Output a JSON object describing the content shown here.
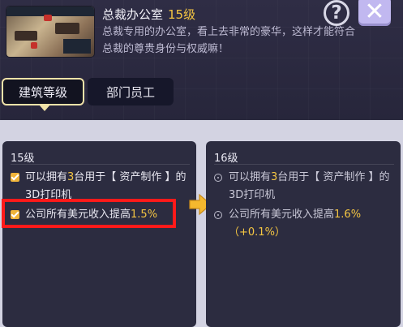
{
  "header": {
    "title": "总裁办公室",
    "level": "15级",
    "description": "总裁专用的办公室，看上去非常的豪华，这样才能符合总裁的尊贵身份与权威嘛！"
  },
  "buttons": {
    "help": "?",
    "close": "✕"
  },
  "tabs": [
    {
      "label": "建筑等级",
      "active": true
    },
    {
      "label": "部门员工",
      "active": false
    }
  ],
  "current": {
    "level": "15级",
    "items": [
      {
        "pre": "可以拥有",
        "num": "3",
        "post": "台用于【 资产制作 】的3D打印机"
      },
      {
        "pre": "公司所有美元收入提高",
        "num": "1.5%",
        "post": ""
      }
    ]
  },
  "next": {
    "level": "16级",
    "items": [
      {
        "pre": "可以拥有",
        "num": "3",
        "post": "台用于【 资产制作 】的3D打印机"
      },
      {
        "pre": "公司所有美元收入提高",
        "num": "1.6%（+0.1%）",
        "post": ""
      }
    ]
  },
  "colors": {
    "highlight": "#f5c642",
    "redbox": "#ff1a1a",
    "arrow": "#f5b82e"
  },
  "icons": {
    "help": "question-circle-icon",
    "close": "close-x-icon",
    "arrow": "arrow-right-icon",
    "check": "checkbox-checked-icon",
    "bullet": "circle-bullet-icon"
  }
}
